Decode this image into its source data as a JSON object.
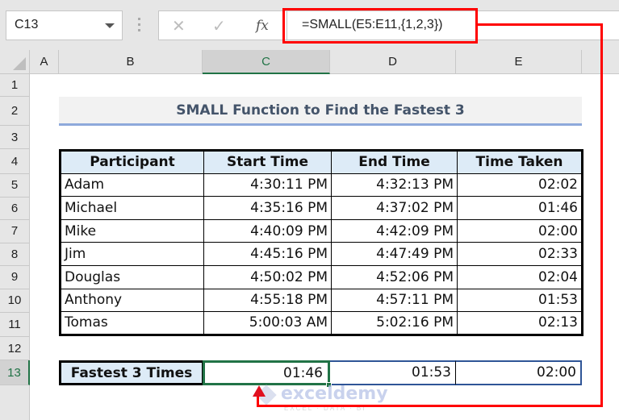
{
  "formula_bar": {
    "name_box": "C13",
    "cancel_icon": "✕",
    "enter_icon": "✓",
    "fx_label": "fx",
    "formula": "=SMALL(E5:E11,{1,2,3})"
  },
  "columns": [
    "A",
    "B",
    "C",
    "D",
    "E"
  ],
  "selected_column": "C",
  "rows": [
    "1",
    "2",
    "3",
    "4",
    "5",
    "6",
    "7",
    "8",
    "9",
    "10",
    "11",
    "12",
    "13"
  ],
  "selected_row": "13",
  "title": "SMALL Function to Find the Fastest 3",
  "table": {
    "headers": [
      "Participant",
      "Start Time",
      "End Time",
      "Time Taken"
    ],
    "rows": [
      [
        "Adam",
        "4:30:11 PM",
        "4:32:13 PM",
        "02:02"
      ],
      [
        "Michael",
        "4:35:16 PM",
        "4:37:02 PM",
        "01:46"
      ],
      [
        "Mike",
        "4:40:09 PM",
        "4:42:09 PM",
        "02:00"
      ],
      [
        "Jim",
        "4:45:16 PM",
        "4:47:49 PM",
        "02:33"
      ],
      [
        "Douglas",
        "4:50:02 PM",
        "4:52:06 PM",
        "02:04"
      ],
      [
        "Anthony",
        "4:55:18 PM",
        "4:57:11 PM",
        "01:53"
      ],
      [
        "Tomas",
        "5:00:03 AM",
        "5:02:16 PM",
        "02:13"
      ]
    ]
  },
  "result": {
    "label": "Fastest 3 Times",
    "values": [
      "01:46",
      "01:53",
      "02:00"
    ]
  },
  "watermark": {
    "brand": "exceldemy",
    "tagline": "EXCEL · DATA · BI"
  },
  "colors": {
    "highlight_red": "#ff0000",
    "excel_green": "#217346",
    "header_fill": "#ddebf7",
    "title_text": "#44546a"
  }
}
